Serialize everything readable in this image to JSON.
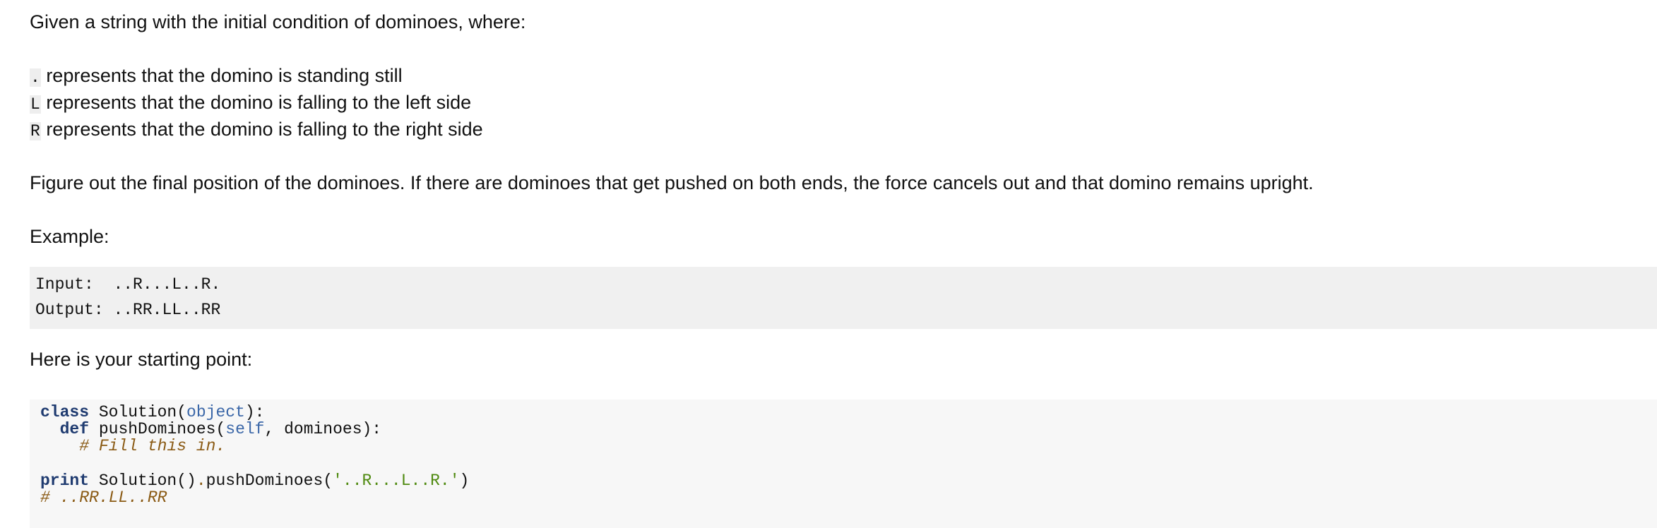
{
  "intro": "Given a string with the initial condition of dominoes, where:",
  "legend": [
    {
      "symbol": ".",
      "text": " represents that the domino is standing still"
    },
    {
      "symbol": "L",
      "text": " represents that the domino is falling to the left side"
    },
    {
      "symbol": "R",
      "text": " represents that the domino is falling to the right side"
    }
  ],
  "description": "Figure out the final position of the dominoes. If there are dominoes that get pushed on both ends, the force cancels out and that domino remains upright.",
  "example_label": "Example:",
  "example": {
    "input_label": "Input:",
    "input_value": "..R...L..R.",
    "output_label": "Output:",
    "output_value": "..RR.LL..RR"
  },
  "starting_point_label": "Here is your starting point:",
  "code": {
    "kw_class": "class",
    "class_name": " Solution(",
    "builtin_object": "object",
    "class_end": "):",
    "kw_def": "def",
    "method_sig_start": " pushDominoes(",
    "builtin_self": "self",
    "method_sig_end": ", dominoes):",
    "comment_fill": "# Fill this in.",
    "kw_print": "print",
    "call_obj": " Solution()",
    "dot": ".",
    "call_method": "pushDominoes(",
    "call_arg": "'..R...L..R.'",
    "call_end": ")",
    "comment_result": "# ..RR.LL..RR"
  }
}
